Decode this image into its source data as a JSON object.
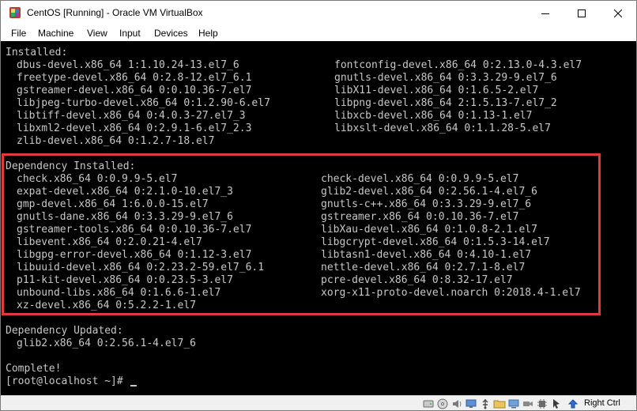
{
  "window": {
    "title": "CentOS [Running] - Oracle VM VirtualBox"
  },
  "menu": [
    "File",
    "Machine",
    "View",
    "Input",
    "Devices",
    "Help"
  ],
  "terminal": {
    "installed_header": "Installed:",
    "installed_left": [
      "dbus-devel.x86_64 1:1.10.24-13.el7_6",
      "freetype-devel.x86_64 0:2.8-12.el7_6.1",
      "gstreamer-devel.x86_64 0:0.10.36-7.el7",
      "libjpeg-turbo-devel.x86_64 0:1.2.90-6.el7",
      "libtiff-devel.x86_64 0:4.0.3-27.el7_3",
      "libxml2-devel.x86_64 0:2.9.1-6.el7_2.3",
      "zlib-devel.x86_64 0:1.2.7-18.el7"
    ],
    "installed_right": [
      "fontconfig-devel.x86_64 0:2.13.0-4.3.el7",
      "gnutls-devel.x86_64 0:3.3.29-9.el7_6",
      "libX11-devel.x86_64 0:1.6.5-2.el7",
      "libpng-devel.x86_64 2:1.5.13-7.el7_2",
      "libxcb-devel.x86_64 0:1.13-1.el7",
      "libxslt-devel.x86_64 0:1.1.28-5.el7"
    ],
    "dep_installed_header": "Dependency Installed:",
    "dep_installed_left": [
      "check.x86_64 0:0.9.9-5.el7",
      "expat-devel.x86_64 0:2.1.0-10.el7_3",
      "gmp-devel.x86_64 1:6.0.0-15.el7",
      "gnutls-dane.x86_64 0:3.3.29-9.el7_6",
      "gstreamer-tools.x86_64 0:0.10.36-7.el7",
      "libevent.x86_64 0:2.0.21-4.el7",
      "libgpg-error-devel.x86_64 0:1.12-3.el7",
      "libuuid-devel.x86_64 0:2.23.2-59.el7_6.1",
      "p11-kit-devel.x86_64 0:0.23.5-3.el7",
      "unbound-libs.x86_64 0:1.6.6-1.el7",
      "xz-devel.x86_64 0:5.2.2-1.el7"
    ],
    "dep_installed_right": [
      "check-devel.x86_64 0:0.9.9-5.el7",
      "glib2-devel.x86_64 0:2.56.1-4.el7_6",
      "gnutls-c++.x86_64 0:3.3.29-9.el7_6",
      "gstreamer.x86_64 0:0.10.36-7.el7",
      "libXau-devel.x86_64 0:1.0.8-2.1.el7",
      "libgcrypt-devel.x86_64 0:1.5.3-14.el7",
      "libtasn1-devel.x86_64 0:4.10-1.el7",
      "nettle-devel.x86_64 0:2.7.1-8.el7",
      "pcre-devel.x86_64 0:8.32-17.el7",
      "xorg-x11-proto-devel.noarch 0:2018.4-1.el7"
    ],
    "dep_updated_header": "Dependency Updated:",
    "dep_updated_items": [
      "glib2.x86_64 0:2.56.1-4.el7_6"
    ],
    "complete": "Complete!",
    "prompt": "[root@localhost ~]# "
  },
  "statusbar": {
    "host_key": "Right Ctrl"
  }
}
